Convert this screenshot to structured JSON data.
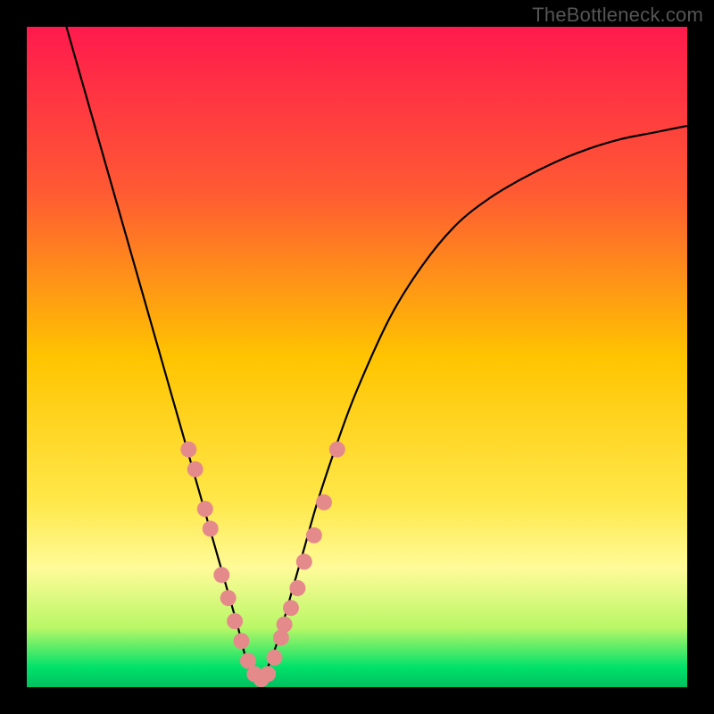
{
  "watermark": "TheBottleneck.com",
  "chart_data": {
    "type": "line",
    "title": "",
    "xlabel": "",
    "ylabel": "",
    "xlim": [
      0,
      100
    ],
    "ylim": [
      0,
      100
    ],
    "background_gradient": {
      "stops": [
        {
          "offset": 0.0,
          "color": "#ff1a4d"
        },
        {
          "offset": 0.25,
          "color": "#ff5a33"
        },
        {
          "offset": 0.5,
          "color": "#ffc400"
        },
        {
          "offset": 0.72,
          "color": "#ffe84a"
        },
        {
          "offset": 0.82,
          "color": "#fffb99"
        },
        {
          "offset": 0.91,
          "color": "#b9f766"
        },
        {
          "offset": 0.97,
          "color": "#00e16a"
        },
        {
          "offset": 1.0,
          "color": "#00c060"
        }
      ]
    },
    "series": [
      {
        "name": "bottleneck-curve",
        "type": "line",
        "stroke": "#000000",
        "x": [
          6,
          8,
          10,
          12,
          14,
          16,
          18,
          20,
          22,
          24,
          26,
          28,
          30,
          32,
          33,
          34,
          35,
          36,
          38,
          40,
          42,
          44,
          47,
          50,
          55,
          60,
          65,
          70,
          75,
          80,
          85,
          90,
          95,
          100
        ],
        "y": [
          100,
          93,
          86,
          79,
          72,
          65,
          58,
          51,
          44,
          37,
          30,
          23,
          16,
          9,
          5,
          2,
          1,
          2,
          7,
          14,
          21,
          28,
          37,
          45,
          56,
          64,
          70,
          74,
          77,
          79.5,
          81.5,
          83,
          84,
          85
        ]
      },
      {
        "name": "highlight-markers",
        "type": "scatter",
        "fill": "#e58a8a",
        "stroke": "#d97070",
        "radius": 9,
        "x": [
          24.5,
          25.5,
          27,
          27.8,
          29.5,
          30.5,
          31.5,
          32.5,
          33.5,
          34.5,
          35.5,
          36.5,
          37.5,
          38.5,
          39,
          40,
          41,
          42,
          43.5,
          45,
          47
        ],
        "y": [
          36,
          33,
          27,
          24,
          17,
          13.5,
          10,
          7,
          4,
          2,
          1.2,
          2,
          4.5,
          7.5,
          9.5,
          12,
          15,
          19,
          23,
          28,
          36
        ]
      }
    ]
  }
}
